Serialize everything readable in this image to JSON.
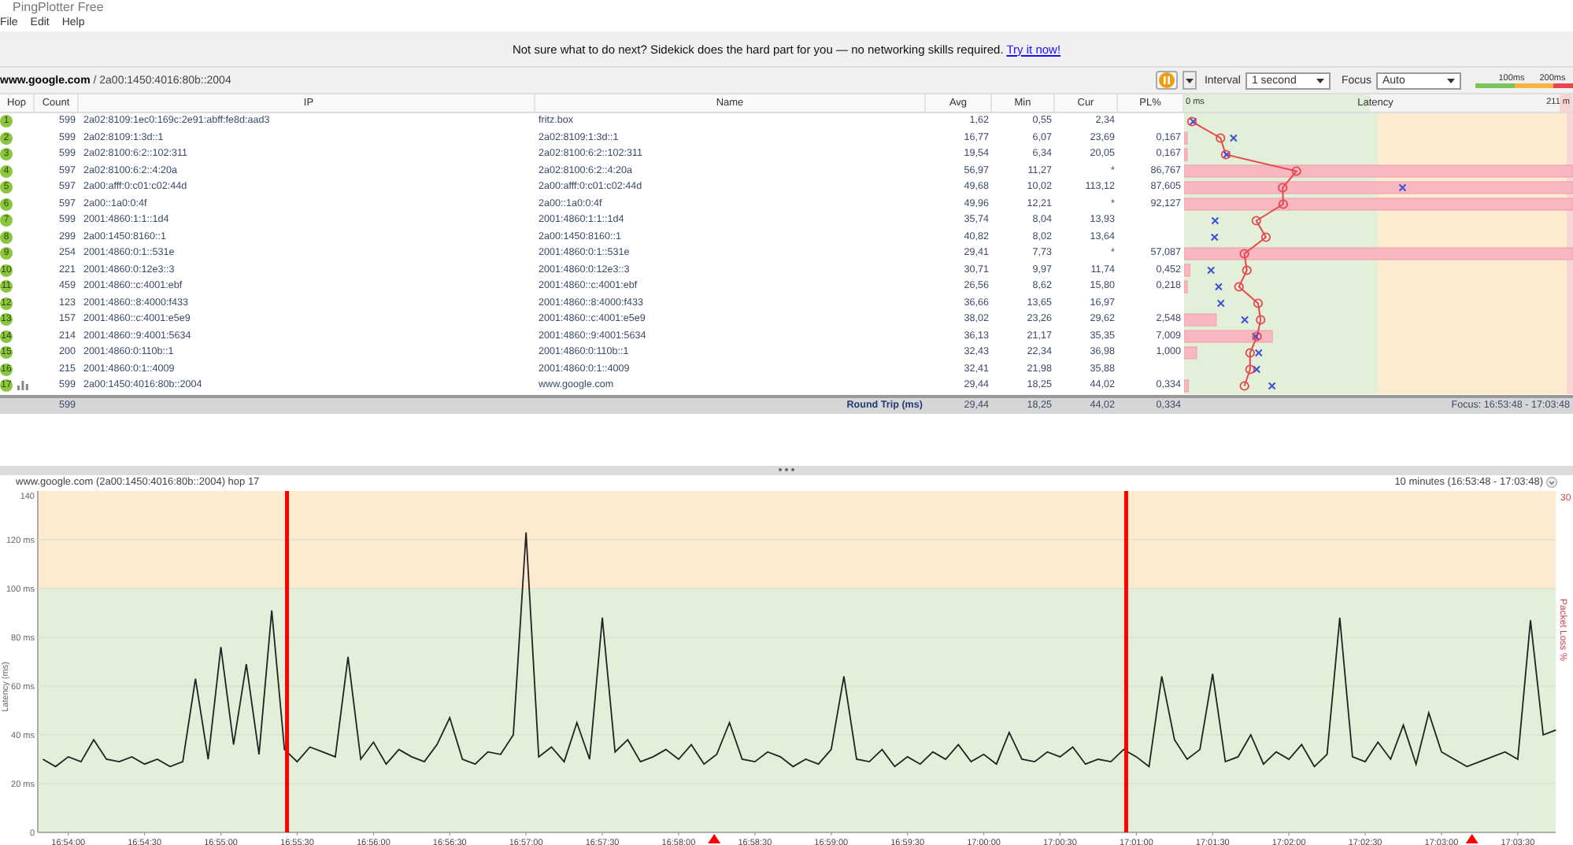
{
  "window": {
    "title": "PingPlotter Free"
  },
  "menu": [
    "File",
    "Edit",
    "Help"
  ],
  "banner": {
    "text": "Not sure what to do next? Sidekick does the hard part for you — no networking skills required.",
    "link": "Try it now!"
  },
  "target": "**www.google.com** / 2a00:1450:4016:80b::2004",
  "toolbar": {
    "interval_label": "Interval",
    "interval": "1 second",
    "focus_label": "Focus",
    "focus": "Auto",
    "scale_labels": [
      "100ms",
      "200ms"
    ]
  },
  "table": {
    "columns": [
      "Hop",
      "Count",
      "IP",
      "Name",
      "Avg",
      "Min",
      "Cur",
      "PL%"
    ],
    "latency_header": {
      "min": "0 ms",
      "title": "Latency",
      "max": "211 m"
    },
    "rows": [
      {
        "hop": "1",
        "count": "599",
        "ip": "2a02:8109:1ec0:169c:2e91:abff:fe8d:aad3",
        "name": "fritz.box",
        "avg": "1,62",
        "min": "0,55",
        "cur": "2,34",
        "pl": "",
        "graphed": false
      },
      {
        "hop": "2",
        "count": "599",
        "ip": "2a02:8109:1:3d::1",
        "name": "2a02:8109:1:3d::1",
        "avg": "16,77",
        "min": "6,07",
        "cur": "23,69",
        "pl": "0,167",
        "graphed": false
      },
      {
        "hop": "3",
        "count": "599",
        "ip": "2a02:8100:6:2::102:311",
        "name": "2a02:8100:6:2::102:311",
        "avg": "19,54",
        "min": "6,34",
        "cur": "20,05",
        "pl": "0,167",
        "graphed": false
      },
      {
        "hop": "4",
        "count": "597",
        "ip": "2a02:8100:6:2::4:20a",
        "name": "2a02:8100:6:2::4:20a",
        "avg": "56,97",
        "min": "11,27",
        "cur": "*",
        "pl": "86,767",
        "graphed": false
      },
      {
        "hop": "5",
        "count": "597",
        "ip": "2a00:afff:0:c01:c02:44d",
        "name": "2a00:afff:0:c01:c02:44d",
        "avg": "49,68",
        "min": "10,02",
        "cur": "113,12",
        "pl": "87,605",
        "graphed": false
      },
      {
        "hop": "6",
        "count": "597",
        "ip": "2a00::1a0:0:4f",
        "name": "2a00::1a0:0:4f",
        "avg": "49,96",
        "min": "12,21",
        "cur": "*",
        "pl": "92,127",
        "graphed": false
      },
      {
        "hop": "7",
        "count": "599",
        "ip": "2001:4860:1:1::1d4",
        "name": "2001:4860:1:1::1d4",
        "avg": "35,74",
        "min": "8,04",
        "cur": "13,93",
        "pl": "",
        "graphed": false
      },
      {
        "hop": "8",
        "count": "299",
        "ip": "2a00:1450:8160::1",
        "name": "2a00:1450:8160::1",
        "avg": "40,82",
        "min": "8,02",
        "cur": "13,64",
        "pl": "",
        "graphed": false
      },
      {
        "hop": "9",
        "count": "254",
        "ip": "2001:4860:0:1::531e",
        "name": "2001:4860:0:1::531e",
        "avg": "29,41",
        "min": "7,73",
        "cur": "*",
        "pl": "57,087",
        "graphed": false
      },
      {
        "hop": "10",
        "count": "221",
        "ip": "2001:4860:0:12e3::3",
        "name": "2001:4860:0:12e3::3",
        "avg": "30,71",
        "min": "9,97",
        "cur": "11,74",
        "pl": "0,452",
        "graphed": false
      },
      {
        "hop": "11",
        "count": "459",
        "ip": "2001:4860::c:4001:ebf",
        "name": "2001:4860::c:4001:ebf",
        "avg": "26,56",
        "min": "8,62",
        "cur": "15,80",
        "pl": "0,218",
        "graphed": false
      },
      {
        "hop": "12",
        "count": "123",
        "ip": "2001:4860::8:4000:f433",
        "name": "2001:4860::8:4000:f433",
        "avg": "36,66",
        "min": "13,65",
        "cur": "16,97",
        "pl": "",
        "graphed": false
      },
      {
        "hop": "13",
        "count": "157",
        "ip": "2001:4860::c:4001:e5e9",
        "name": "2001:4860::c:4001:e5e9",
        "avg": "38,02",
        "min": "23,26",
        "cur": "29,62",
        "pl": "2,548",
        "graphed": false
      },
      {
        "hop": "14",
        "count": "214",
        "ip": "2001:4860::9:4001:5634",
        "name": "2001:4860::9:4001:5634",
        "avg": "36,13",
        "min": "21,17",
        "cur": "35,35",
        "pl": "7,009",
        "graphed": false
      },
      {
        "hop": "15",
        "count": "200",
        "ip": "2001:4860:0:110b::1",
        "name": "2001:4860:0:110b::1",
        "avg": "32,43",
        "min": "22,34",
        "cur": "36,98",
        "pl": "1,000",
        "graphed": false
      },
      {
        "hop": "16",
        "count": "215",
        "ip": "2001:4860:0:1::4009",
        "name": "2001:4860:0:1::4009",
        "avg": "32,41",
        "min": "21,98",
        "cur": "35,88",
        "pl": "",
        "graphed": false
      },
      {
        "hop": "17",
        "count": "599",
        "ip": "2a00:1450:4016:80b::2004",
        "name": "www.google.com",
        "avg": "29,44",
        "min": "18,25",
        "cur": "44,02",
        "pl": "0,334",
        "graphed": true
      }
    ],
    "footer": {
      "count": "599",
      "label": "Round Trip (ms)",
      "avg": "29,44",
      "min": "18,25",
      "cur": "44,02",
      "pl": "0,334",
      "focus": "Focus: 16:53:48 - 17:03:48"
    }
  },
  "graph": {
    "title": "www.google.com (2a00:1450:4016:80b::2004) hop 17",
    "range": "10 minutes (16:53:48 - 17:03:48)",
    "right_axis": {
      "max_label": "30",
      "title": "Packet Loss %"
    },
    "chart_data": {
      "type": "line",
      "ylabel": "Latency (ms)",
      "ylim": [
        0,
        140
      ],
      "categories": [
        null,
        null,
        "16:54:00",
        null,
        null,
        null,
        null,
        null,
        "16:54:30",
        null,
        null,
        null,
        null,
        null,
        "16:55:00",
        null,
        null,
        null,
        null,
        null,
        "16:55:30",
        null,
        null,
        null,
        null,
        null,
        "16:56:00",
        null,
        null,
        null,
        null,
        null,
        "16:56:30",
        null,
        null,
        null,
        null,
        null,
        "16:57:00",
        null,
        null,
        null,
        null,
        null,
        "16:57:30",
        null,
        null,
        null,
        null,
        null,
        "16:58:00",
        null,
        null,
        null,
        null,
        null,
        "16:58:30",
        null,
        null,
        null,
        null,
        null,
        "16:59:00",
        null,
        null,
        null,
        null,
        null,
        "16:59:30",
        null,
        null,
        null,
        null,
        null,
        "17:00:00",
        null,
        null,
        null,
        null,
        null,
        "17:00:30",
        null,
        null,
        null,
        null,
        null,
        "17:01:00",
        null,
        null,
        null,
        null,
        null,
        "17:01:30",
        null,
        null,
        null,
        null,
        null,
        "17:02:00",
        null,
        null,
        null,
        null,
        null,
        "17:02:30",
        null,
        null,
        null,
        null,
        null,
        "17:03:00",
        null,
        null,
        null,
        null,
        null,
        "17:03:30",
        null,
        null,
        null
      ],
      "yticks": [
        {
          "value": 0,
          "label": "0"
        },
        {
          "value": 20,
          "label": "20 ms"
        },
        {
          "value": 40,
          "label": "40 ms"
        },
        {
          "value": 60,
          "label": "60 ms"
        },
        {
          "value": 80,
          "label": "80 ms"
        },
        {
          "value": 100,
          "label": "100 ms"
        },
        {
          "value": 120,
          "label": "120 ms"
        },
        {
          "value": 140,
          "label": "140"
        }
      ],
      "series": [
        {
          "color": "#222222",
          "values": [
            30,
            27,
            31,
            29,
            38,
            30,
            29,
            31,
            28,
            30,
            27,
            29,
            63,
            30,
            76,
            36,
            69,
            32,
            91,
            34,
            29,
            35,
            33,
            31,
            72,
            30,
            37,
            28,
            34,
            31,
            29,
            36,
            47,
            30,
            28,
            33,
            32,
            40,
            123,
            31,
            35,
            29,
            45,
            30,
            88,
            33,
            38,
            29,
            31,
            34,
            30,
            36,
            28,
            32,
            45,
            30,
            29,
            33,
            31,
            27,
            30,
            28,
            34,
            64,
            30,
            29,
            34,
            27,
            31,
            28,
            33,
            30,
            36,
            29,
            32,
            28,
            41,
            30,
            29,
            33,
            31,
            35,
            28,
            30,
            29,
            34,
            31,
            27,
            64,
            38,
            30,
            34,
            65,
            29,
            31,
            40,
            28,
            33,
            30,
            36,
            27,
            32,
            88,
            31,
            29,
            37,
            30,
            44,
            28,
            49,
            33,
            30,
            27,
            29,
            31,
            33,
            30,
            87,
            40,
            42
          ]
        }
      ],
      "grid": true
    }
  }
}
